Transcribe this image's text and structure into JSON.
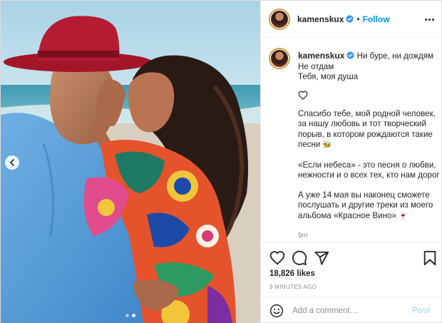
{
  "account": {
    "username": "kamenskux",
    "separator": "•",
    "follow_label": "Follow"
  },
  "caption": {
    "lines": [
      "Ни буре, ни дождям",
      "Не отдам",
      "Тебя, моя душа"
    ],
    "paragraph1": "Спасибо тебе, мой родной человек, за нашу любовь и тот творческий порыв, в котором рождаются такие песни",
    "paragraph1_emoji": "🐝",
    "paragraph2": "«Если небеса» - это песня о любви, нежности и о всех тех, кто нам дорог",
    "paragraph3": "А уже 14 мая вы наконец сможете послушать и другие треки из моего альбома «Красное Вино»",
    "paragraph3_emoji": "🍷",
    "time": "9m"
  },
  "stats": {
    "likes": "18,826 likes",
    "posted": "9 MINUTES AGO"
  },
  "comment": {
    "placeholder": "Add a comment…",
    "post_label": "Post"
  },
  "icons": {
    "verified": "verified-badge-icon",
    "more": "more-options-icon",
    "like": "heart-icon",
    "comment": "comment-bubble-icon",
    "share": "paper-plane-icon",
    "save": "bookmark-icon",
    "emoji": "smiley-icon",
    "prev": "chevron-left-icon"
  },
  "carousel": {
    "slides": 2,
    "active_slide": 2
  },
  "colors": {
    "accent_blue": "#0095f6",
    "post_disabled": "#b2dffc",
    "muted": "#8e8e8e",
    "text": "#262626"
  }
}
